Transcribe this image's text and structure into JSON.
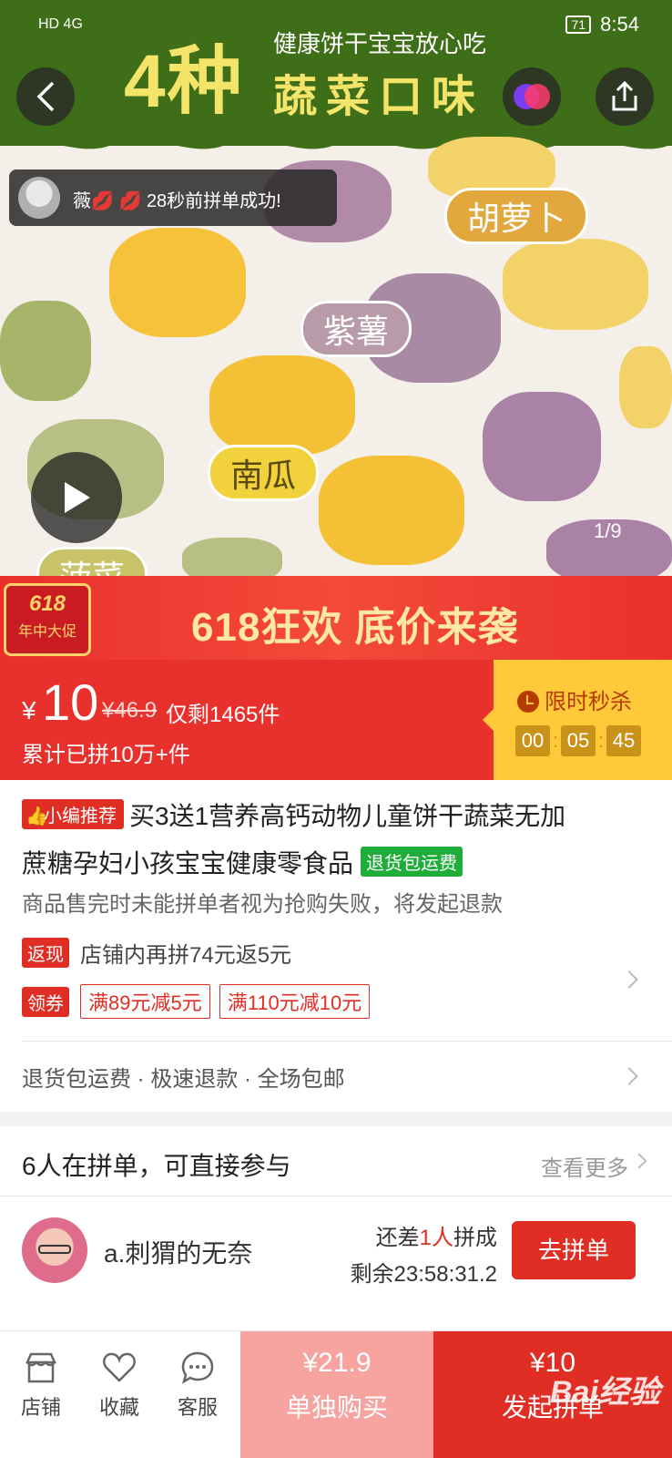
{
  "status_bar": {
    "network": "HD 4G",
    "battery": "71",
    "time": "8:54"
  },
  "hero": {
    "banner_big": "4种",
    "banner_small": "健康饼干宝宝放心吃",
    "banner_mid": "蔬菜口味",
    "labels": {
      "carrot": "胡萝卜",
      "purple_potato": "紫薯",
      "pumpkin": "南瓜",
      "spinach": "菠菜"
    },
    "notification": {
      "user": "薇💋 💋",
      "text": "28秒前拼单成功!"
    },
    "image_counter": "1/9"
  },
  "promo": {
    "badge_top": "618",
    "badge_bottom": "年中大促",
    "title": "618狂欢 底价来袭"
  },
  "price": {
    "currency": "¥",
    "current": "10",
    "original": "¥46.9",
    "stock": "仅剩1465件",
    "sold": "累计已拼10万+件",
    "flash_label": "限时秒杀",
    "timer": {
      "h": "00",
      "m": "05",
      "s": "45"
    }
  },
  "product": {
    "rec_badge": "小编推荐",
    "title_line1": "买3送1营养高钙动物儿童饼干蔬菜无加",
    "title_line2": "蔗糖孕妇小孩宝宝健康零食品",
    "free_return_tag": "退货包运费",
    "notice": "商品售完时未能拼单者视为抢购失败，将发起退款",
    "cashback_tag": "返现",
    "cashback_text": "店铺内再拼74元返5元",
    "coupon_tag": "领券",
    "coupons": [
      "满89元减5元",
      "满110元减10元"
    ],
    "services": "退货包运费 · 极速退款 · 全场包邮"
  },
  "group_buy": {
    "title": "6人在拼单，可直接参与",
    "more": "查看更多",
    "entry": {
      "name": "a.刺猬的无奈",
      "need_prefix": "还差",
      "need_count": "1人",
      "need_suffix": "拼成",
      "remaining": "剩余23:58:31.2",
      "button": "去拼单"
    }
  },
  "bottom_bar": {
    "store": "店铺",
    "favorite": "收藏",
    "service": "客服",
    "solo_price": "¥21.9",
    "solo_label": "单独购买",
    "group_price": "¥10",
    "group_label": "发起拼单"
  },
  "watermark": "Bai经验",
  "colors": {
    "primary_red": "#e02e24",
    "flash_yellow": "#ffc93a",
    "banner_green": "#3f6e18",
    "green_tag": "#1fad3a"
  }
}
